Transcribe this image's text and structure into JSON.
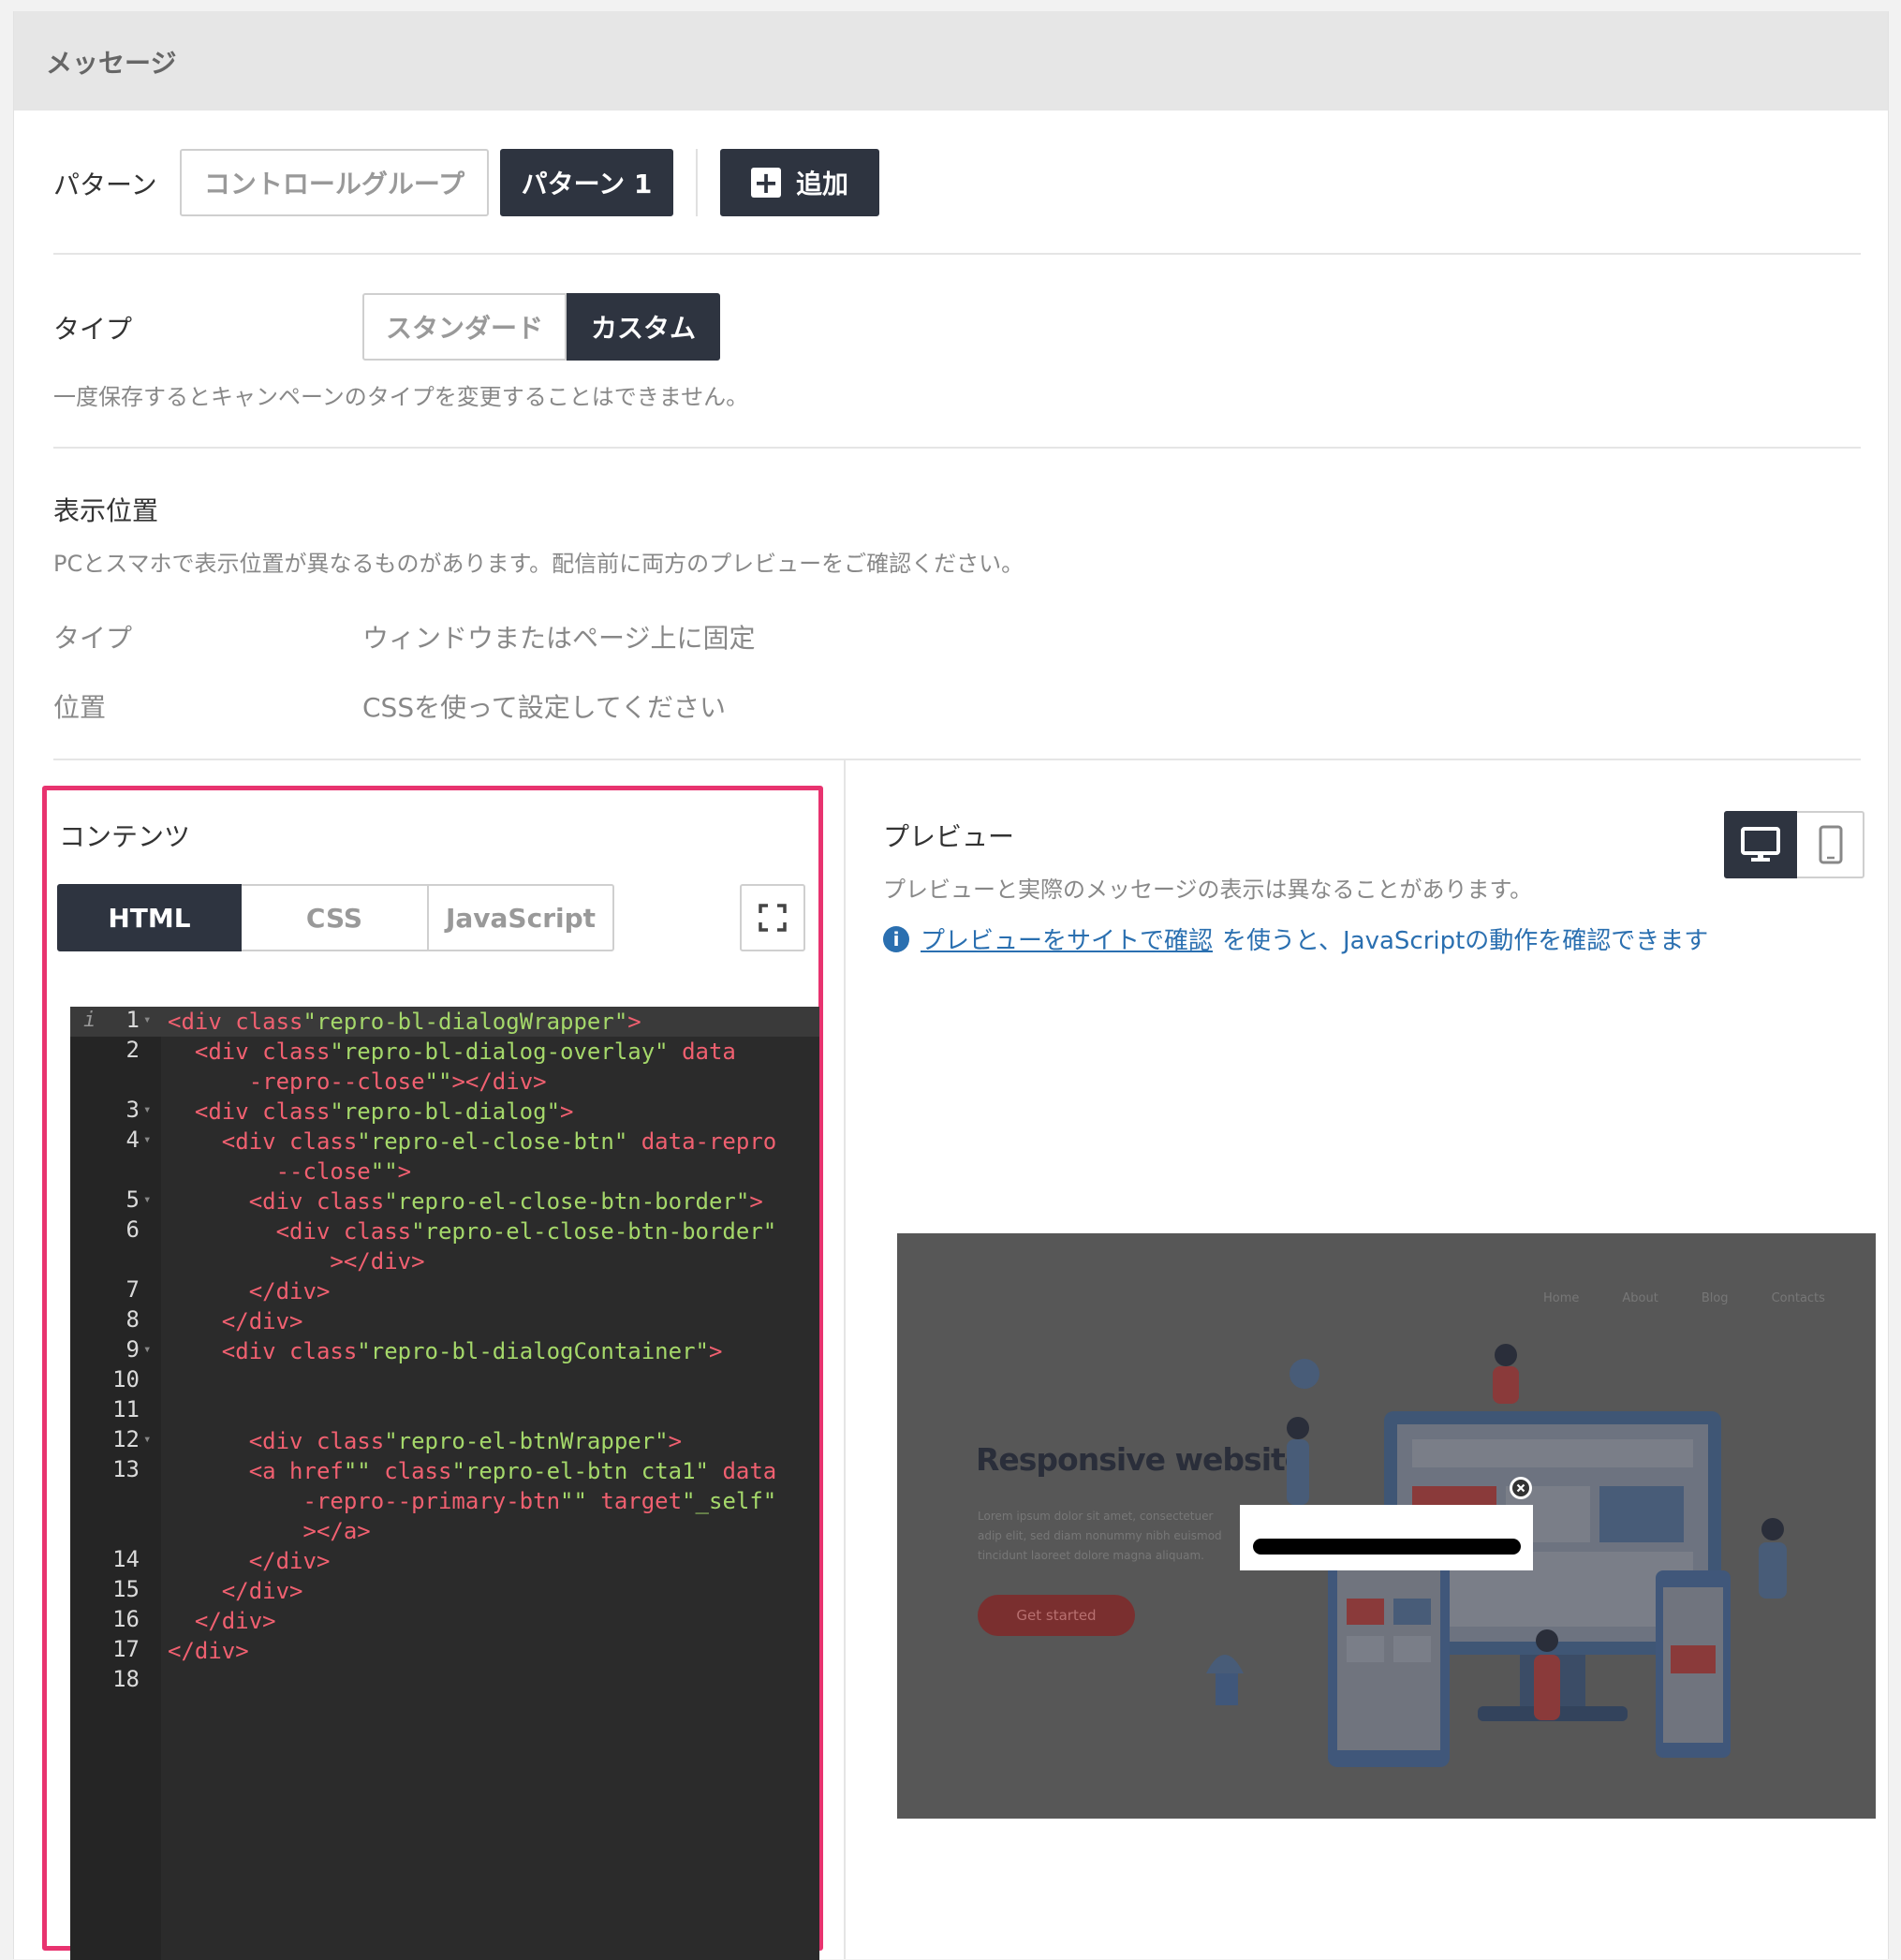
{
  "header": {
    "title": "メッセージ"
  },
  "pattern": {
    "label": "パターン",
    "items": [
      "コントロールグループ",
      "パターン 1"
    ],
    "add_label": "追加"
  },
  "type": {
    "label": "タイプ",
    "options": [
      "スタンダード",
      "カスタム"
    ],
    "selected": "カスタム",
    "note": "一度保存するとキャンペーンのタイプを変更することはできません。"
  },
  "position": {
    "title": "表示位置",
    "note": "PCとスマホで表示位置が異なるものがあります。配信前に両方のプレビューをご確認ください。",
    "rows": [
      {
        "key": "タイプ",
        "value": "ウィンドウまたはページ上に固定"
      },
      {
        "key": "位置",
        "value": "CSSを使って設定してください"
      }
    ]
  },
  "contents": {
    "title": "コンテンツ",
    "tabs": [
      "HTML",
      "CSS",
      "JavaScript"
    ],
    "active_tab": "HTML",
    "line_numbers": [
      "1",
      "2",
      "3",
      "4",
      "5",
      "6",
      "7",
      "8",
      "9",
      "10",
      "11",
      "12",
      "13",
      "14",
      "15",
      "16",
      "17",
      "18"
    ],
    "code_lines": [
      "<div class=\"repro-bl-dialogWrapper\">",
      "  <div class=\"repro-bl-dialog-overlay\" data",
      "      -repro--close=\"\"></div>",
      "  <div class=\"repro-bl-dialog\">",
      "    <div class=\"repro-el-close-btn\" data-repro",
      "        --close=\"\">",
      "      <div class=\"repro-el-close-btn-border\">",
      "        <div class=\"repro-el-close-btn-border\"",
      "            ></div>",
      "      </div>",
      "    </div>",
      "    <div class=\"repro-bl-dialogContainer\">",
      "",
      "",
      "      <div class=\"repro-el-btnWrapper\">",
      "      <a href=\"\" class=\"repro-el-btn cta1\" data",
      "          -repro--primary-btn=\"\" target=\"_self\"",
      "          ></a>",
      "      </div>",
      "    </div>",
      "  </div>",
      "</div>",
      ""
    ]
  },
  "preview": {
    "title": "プレビュー",
    "note": "プレビューと実際のメッセージの表示は異なることがあります。",
    "link_text": "プレビューをサイトで確認",
    "info_rest": "を使うと、JavaScriptの動作を確認できます",
    "device_icons": [
      "desktop-icon",
      "mobile-icon"
    ],
    "site": {
      "nav": [
        "Home",
        "About",
        "Blog",
        "Contacts"
      ],
      "headline": "Responsive website",
      "body": "Lorem ipsum dolor sit amet, consectetuer adip elit, sed diam nonummy nibh euismod tincidunt laoreet dolore magna aliquam.",
      "cta": "Get started"
    }
  },
  "colors": {
    "dark": "#2e3440",
    "highlight": "#e8336f",
    "link": "#2a6fb0",
    "code_bg": "#2b2b2b"
  }
}
